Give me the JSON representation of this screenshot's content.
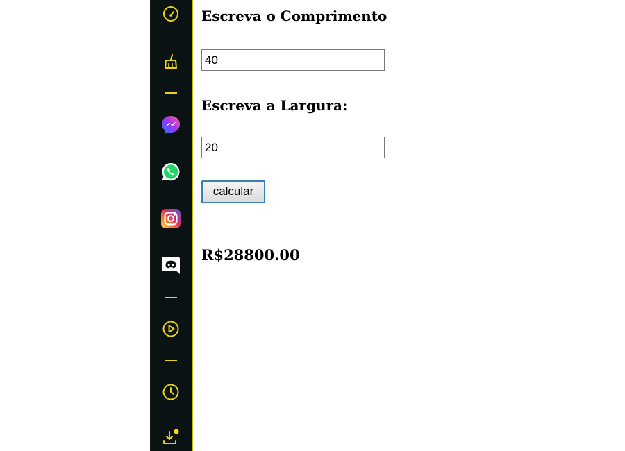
{
  "sidebar": {
    "accent_color": "#e7d312",
    "background_color": "#0b1214",
    "icons": [
      {
        "name": "speedometer-icon"
      },
      {
        "name": "broom-icon"
      },
      {
        "name": "messenger-icon"
      },
      {
        "name": "whatsapp-icon"
      },
      {
        "name": "instagram-icon"
      },
      {
        "name": "discord-icon"
      },
      {
        "name": "player-icon"
      },
      {
        "name": "history-clock-icon"
      },
      {
        "name": "downloads-icon",
        "badge": true
      }
    ]
  },
  "form": {
    "length_label": "Escreva o Comprimento",
    "length_value": "40",
    "width_label": "Escreva a Largura:",
    "width_value": "20",
    "calculate_button": "calcular",
    "result_text": "R$28800.00"
  }
}
